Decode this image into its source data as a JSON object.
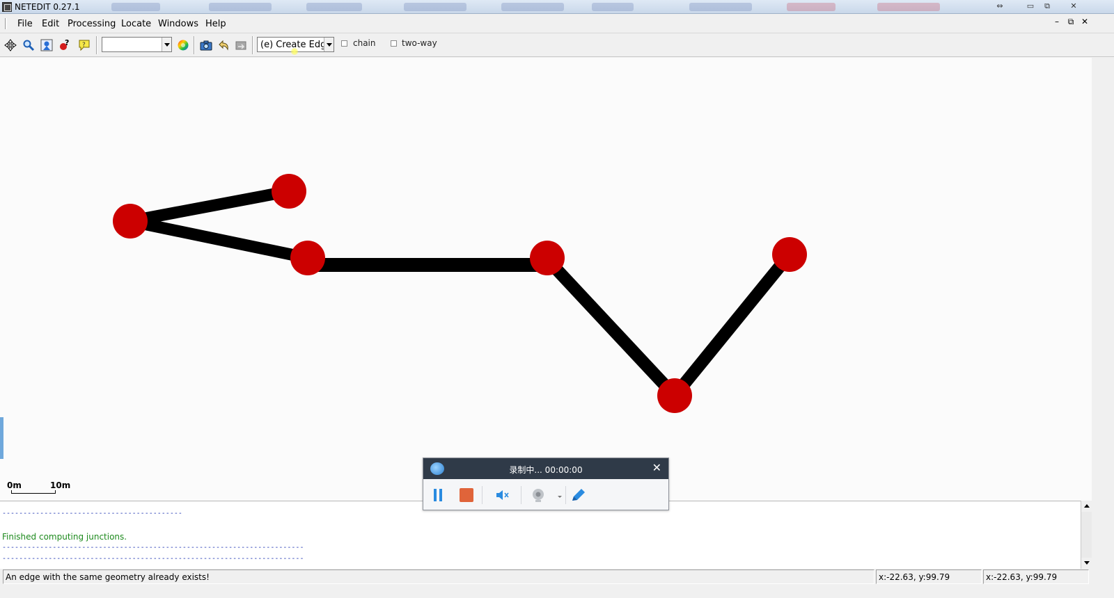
{
  "window": {
    "title": "NETEDIT 0.27.1",
    "controls": [
      "restore-icon",
      "minimize-icon",
      "maximize-icon",
      "close-icon"
    ]
  },
  "menu": {
    "items": [
      {
        "label": "File"
      },
      {
        "label": "Edit"
      },
      {
        "label": "Processing"
      },
      {
        "label": "Locate"
      },
      {
        "label": "Windows"
      },
      {
        "label": "Help"
      }
    ],
    "mdi_controls": [
      "–",
      "⧉",
      "✕"
    ]
  },
  "toolbar": {
    "buttons": [
      "recenter-view-icon",
      "zoom-icon",
      "locate-junction-icon",
      "locate-edge-icon",
      "tooltip-icon"
    ],
    "viewport_combo": {
      "value": ""
    },
    "color_icon": "color-wheel-icon",
    "buttons2": [
      "screenshot-icon",
      "undo-icon",
      "redo-icon"
    ],
    "mode_select": {
      "value": "(e) Create Edge"
    },
    "checkboxes": [
      {
        "label": "chain",
        "checked": false
      },
      {
        "label": "two-way",
        "checked": false
      }
    ]
  },
  "network": {
    "junction_color": "#cc0000",
    "edge_color": "#000000",
    "junction_count": 6,
    "edge_count": 5
  },
  "scale": {
    "start": "0m",
    "end": "10m"
  },
  "recorder": {
    "title": "录制中... 00:00:00",
    "controls": [
      "pause-icon",
      "stop-icon",
      "mute-icon",
      "webcam-icon",
      "pen-icon"
    ]
  },
  "log": {
    "messages": [
      "Finished computing junctions."
    ],
    "message_color": "#1d8a1d"
  },
  "status": {
    "message": "An edge with the same geometry already exists!",
    "coords1": "x:-22.63, y:99.79",
    "coords2": "x:-22.63, y:99.79"
  }
}
